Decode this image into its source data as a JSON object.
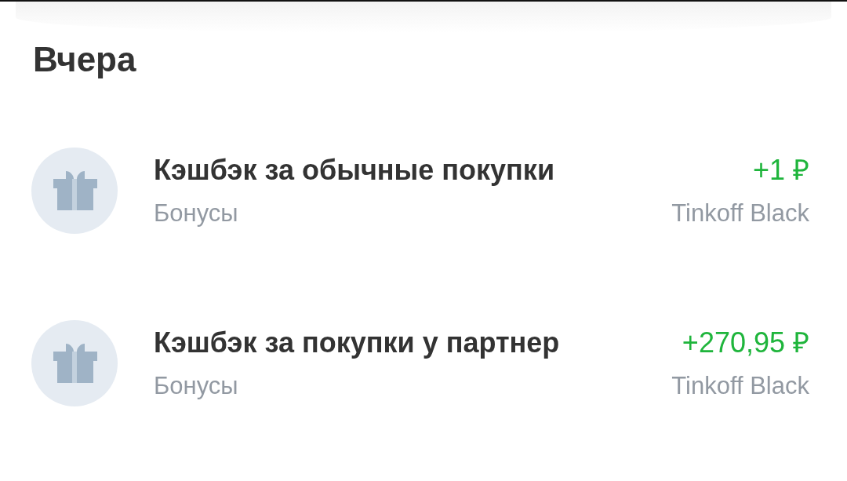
{
  "section_title": "Вчера",
  "operations": [
    {
      "title": "Кэшбэк за обычные покупки",
      "category": "Бонусы",
      "amount": "+1 ₽",
      "account": "Tinkoff Black"
    },
    {
      "title": "Кэшбэк за покупки у партнер",
      "category": "Бонусы",
      "amount": "+270,95 ₽",
      "account": "Tinkoff Black"
    }
  ]
}
